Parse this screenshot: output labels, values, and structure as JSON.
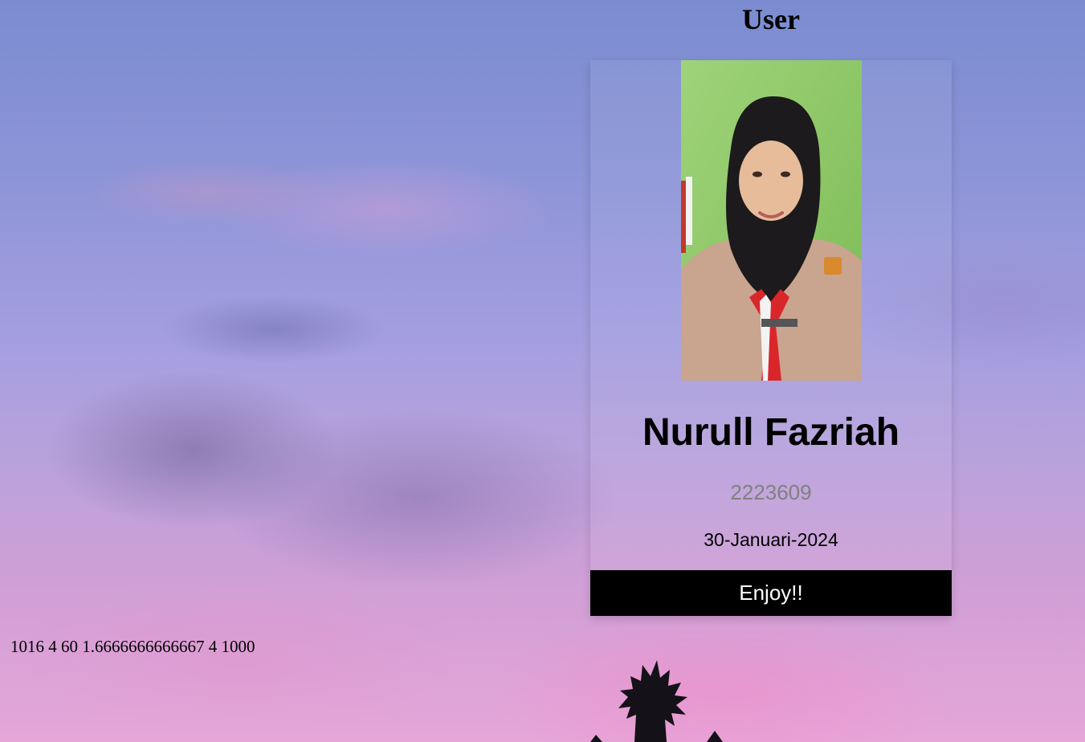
{
  "header": {
    "title": "User"
  },
  "card": {
    "photo_description": "profile photo",
    "name": "Nurull Fazriah",
    "id": "2223609",
    "date": "30-Januari-2024",
    "button_label": "Enjoy!!"
  },
  "debug": {
    "text": "1016 4 60 1.6666666666667 4 1000"
  },
  "colors": {
    "button_bg": "#000000",
    "button_text": "#ffffff",
    "id_text": "#808080"
  }
}
